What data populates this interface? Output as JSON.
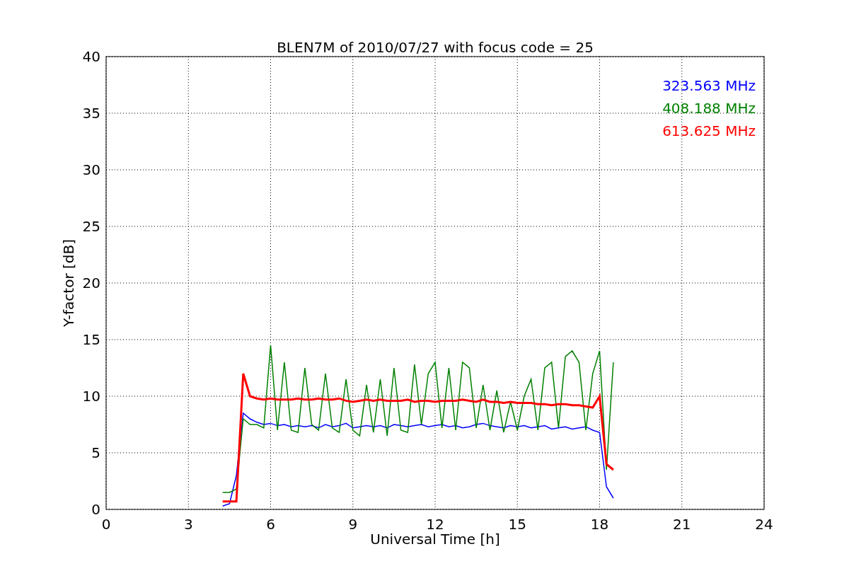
{
  "chart_data": {
    "type": "line",
    "title": "BLEN7M of 2010/07/27 with focus code = 25",
    "xlabel": "Universal Time [h]",
    "ylabel": "Y-factor [dB]",
    "x": [
      4.25,
      4.5,
      4.75,
      5,
      5.25,
      5.5,
      5.75,
      6,
      6.25,
      6.5,
      6.75,
      7,
      7.25,
      7.5,
      7.75,
      8,
      8.25,
      8.5,
      8.75,
      9,
      9.25,
      9.5,
      9.75,
      10,
      10.25,
      10.5,
      10.75,
      11,
      11.25,
      11.5,
      11.75,
      12,
      12.25,
      12.5,
      12.75,
      13,
      13.25,
      13.5,
      13.75,
      14,
      14.25,
      14.5,
      14.75,
      15,
      15.25,
      15.5,
      15.75,
      16,
      16.25,
      16.5,
      16.75,
      17,
      17.25,
      17.5,
      17.75,
      18,
      18.25,
      18.5
    ],
    "series": [
      {
        "name": "323.563 MHz",
        "color": "#0000ff",
        "values": [
          0.3,
          0.5,
          3.0,
          8.5,
          8.0,
          7.7,
          7.5,
          7.6,
          7.4,
          7.5,
          7.3,
          7.4,
          7.3,
          7.4,
          7.2,
          7.5,
          7.3,
          7.4,
          7.6,
          7.2,
          7.3,
          7.4,
          7.3,
          7.4,
          7.2,
          7.5,
          7.4,
          7.3,
          7.4,
          7.5,
          7.3,
          7.4,
          7.5,
          7.3,
          7.4,
          7.2,
          7.3,
          7.5,
          7.6,
          7.4,
          7.3,
          7.2,
          7.4,
          7.3,
          7.4,
          7.2,
          7.3,
          7.4,
          7.1,
          7.2,
          7.3,
          7.1,
          7.2,
          7.3,
          7.0,
          6.8,
          2.0,
          1.0
        ]
      },
      {
        "name": "408.188 MHz",
        "color": "#008000",
        "values": [
          1.5,
          1.5,
          1.8,
          8.0,
          7.5,
          7.5,
          7.2,
          14.5,
          7.0,
          13.0,
          7.0,
          6.8,
          12.5,
          7.5,
          7.0,
          12.0,
          7.2,
          6.8,
          11.5,
          7.0,
          6.5,
          11.0,
          6.8,
          11.5,
          6.5,
          12.5,
          7.0,
          6.8,
          12.8,
          7.5,
          12.0,
          13.0,
          7.2,
          12.5,
          7.0,
          13.0,
          12.5,
          7.2,
          11.0,
          7.0,
          10.5,
          6.8,
          9.5,
          7.0,
          10.0,
          11.5,
          7.0,
          12.5,
          13.0,
          7.2,
          13.5,
          14.0,
          13.0,
          7.0,
          12.0,
          14.0,
          3.5,
          13.0
        ]
      },
      {
        "name": "613.625 MHz",
        "color": "#ff0000",
        "values": [
          0.7,
          0.7,
          0.7,
          12.0,
          10.0,
          9.8,
          9.7,
          9.8,
          9.7,
          9.7,
          9.7,
          9.8,
          9.7,
          9.7,
          9.8,
          9.7,
          9.7,
          9.8,
          9.6,
          9.5,
          9.6,
          9.7,
          9.6,
          9.7,
          9.6,
          9.6,
          9.6,
          9.7,
          9.5,
          9.6,
          9.6,
          9.5,
          9.6,
          9.6,
          9.6,
          9.7,
          9.6,
          9.5,
          9.7,
          9.5,
          9.5,
          9.4,
          9.5,
          9.4,
          9.4,
          9.4,
          9.3,
          9.3,
          9.2,
          9.3,
          9.3,
          9.2,
          9.2,
          9.1,
          9.0,
          10.0,
          4.0,
          3.5
        ]
      }
    ],
    "grid": true,
    "xlim": [
      0,
      24
    ],
    "ylim": [
      0,
      40
    ],
    "xticks": [
      0,
      3,
      6,
      9,
      12,
      15,
      18,
      21,
      24
    ],
    "yticks": [
      0,
      5,
      10,
      15,
      20,
      25,
      30,
      35,
      40
    ]
  }
}
